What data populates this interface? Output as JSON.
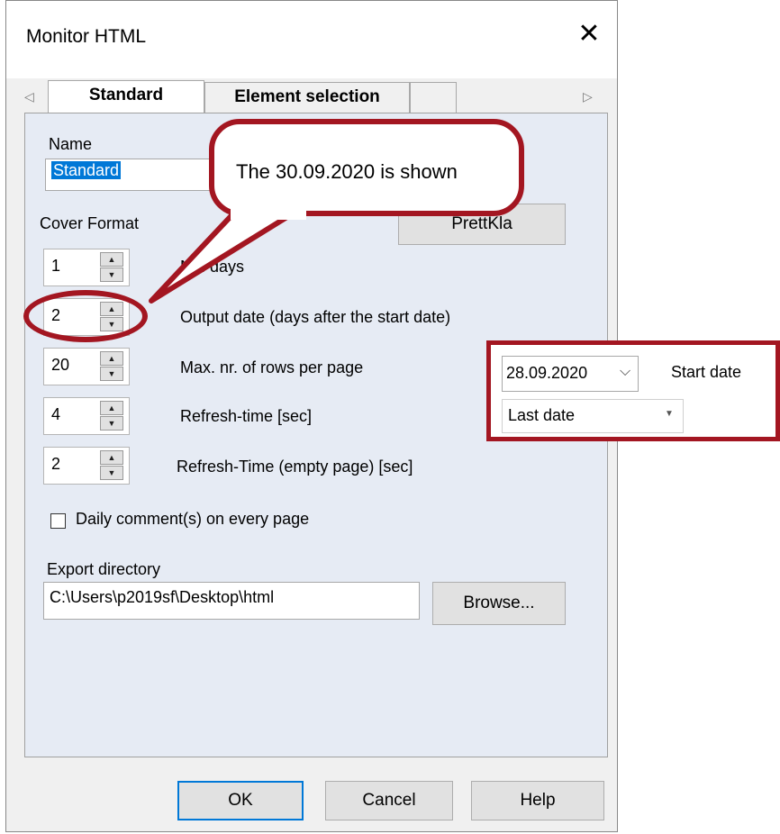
{
  "dialog": {
    "title": "Monitor HTML",
    "tabs": [
      "Standard",
      "Element selection",
      ""
    ],
    "name_label": "Name",
    "name_value": "Standard",
    "cover_format_label": "Cover Format",
    "cover_format_button": "PrettKla",
    "spinners": [
      {
        "value": "1",
        "label": "N... days"
      },
      {
        "value": "2",
        "label": "Output date (days after the start date)"
      },
      {
        "value": "20",
        "label": "Max. nr. of rows per page"
      },
      {
        "value": "4",
        "label": "Refresh-time [sec]"
      },
      {
        "value": "2",
        "label": "Refresh-Time (empty page) [sec]"
      }
    ],
    "daily_comment_label": "Daily comment(s) on every page",
    "export_label": "Export directory",
    "export_path": "C:\\Users\\p2019sf\\Desktop\\html",
    "browse_button": "Browse...",
    "ok_button": "OK",
    "cancel_button": "Cancel",
    "help_button": "Help"
  },
  "callout": {
    "text": "The 30.09.2020 is shown"
  },
  "date_panel": {
    "date_value": "28.09.2020",
    "start_date_label": "Start date",
    "mode_value": "Last date"
  },
  "colors": {
    "annotation": "#a31621",
    "focus": "#0078d7",
    "tab_page": "#e6ebf4"
  },
  "icons": [
    "close-icon",
    "chevron-left-icon",
    "chevron-right-icon",
    "spin-up-icon",
    "spin-down-icon",
    "chevron-down-icon",
    "dropdown-arrow-icon"
  ]
}
